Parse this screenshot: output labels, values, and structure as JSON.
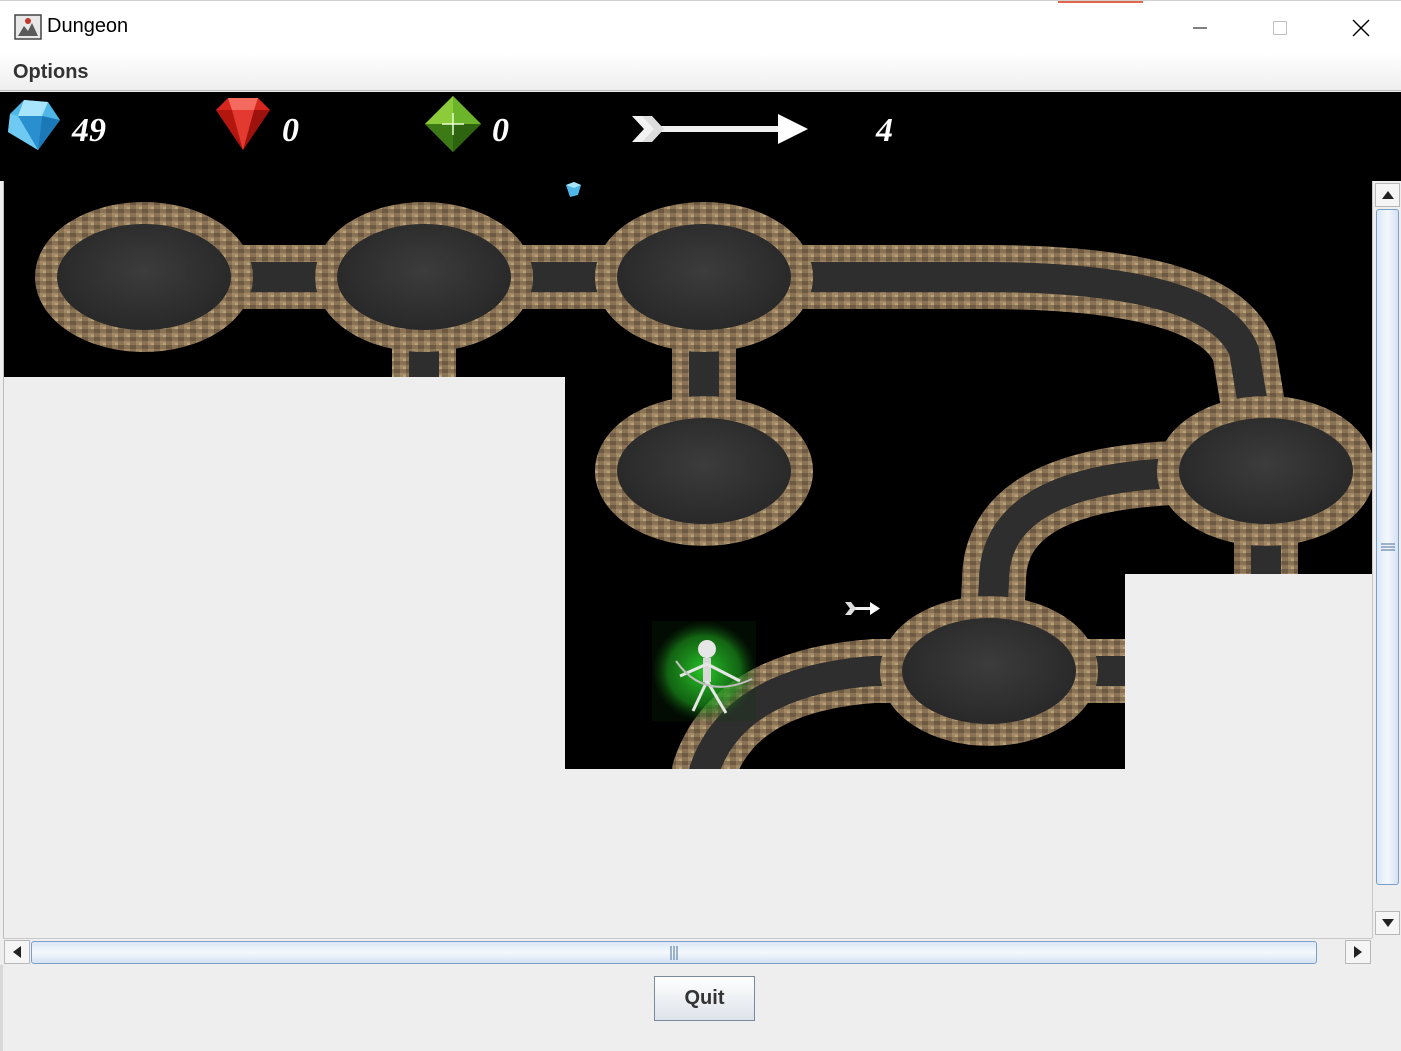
{
  "window": {
    "title": "Dungeon",
    "icon": "java-app-icon",
    "accent": "#e2674a"
  },
  "window_controls": [
    {
      "name": "minimize-button",
      "icon": "minimize-icon"
    },
    {
      "name": "maximize-button",
      "icon": "maximize-icon"
    },
    {
      "name": "close-button",
      "icon": "close-icon"
    }
  ],
  "menubar": {
    "items": [
      {
        "label": "Options"
      }
    ]
  },
  "hud": {
    "sapphires": {
      "icon": "blue-diamond-icon",
      "count": "49",
      "color": "#4fb6e8"
    },
    "rubies": {
      "icon": "red-ruby-icon",
      "count": "0",
      "color": "#d7261e"
    },
    "emeralds": {
      "icon": "green-emerald-icon",
      "count": "0",
      "color": "#4f9a1e"
    },
    "arrows": {
      "icon": "arrow-icon",
      "count": "4"
    }
  },
  "map": {
    "background": "#000000",
    "unexplored_color": "#eeeeee",
    "items": [
      {
        "type": "sapphire",
        "icon": "small-diamond-icon"
      },
      {
        "type": "arrow",
        "icon": "arrow-pickup-icon"
      }
    ],
    "player": {
      "icon": "skeleton-archer-icon",
      "glow": "#2bd12b"
    }
  },
  "scrollbars": {
    "vertical": "vertical-scrollbar",
    "horizontal": "horizontal-scrollbar"
  },
  "footer": {
    "quit_label": "Quit"
  }
}
